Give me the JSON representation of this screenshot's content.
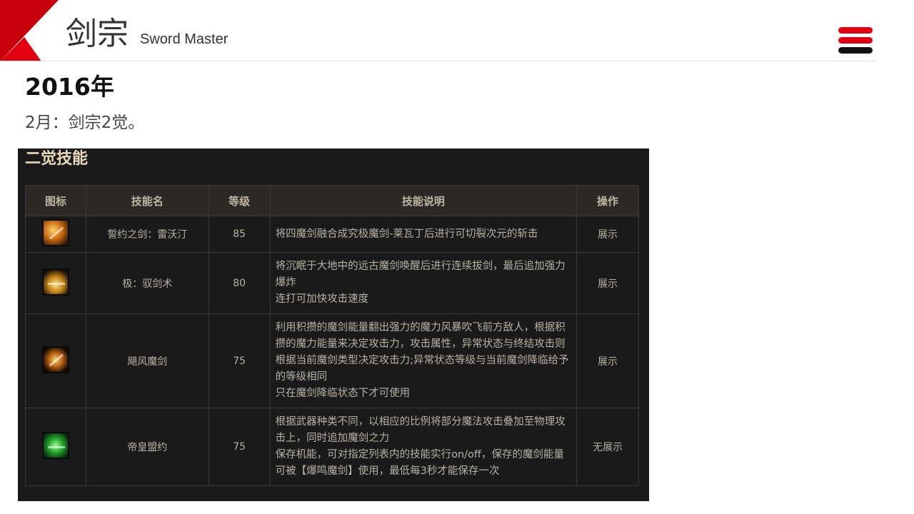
{
  "header": {
    "title": "剑宗",
    "subtitle": "Sword Master",
    "accent_color": "#d7000f"
  },
  "content": {
    "year": "2016年",
    "note": "2月：剑宗2觉。"
  },
  "panel": {
    "title": "二觉技能",
    "columns": [
      "图标",
      "技能名",
      "等级",
      "技能说明",
      "操作"
    ],
    "rows": [
      {
        "icon": "sword-skill-icon",
        "name": "誓约之剑：雷沃汀",
        "level": "85",
        "desc": [
          "将四魔剑融合成究极魔剑-莱瓦丁后进行可切裂次元的斩击"
        ],
        "action": "展示"
      },
      {
        "icon": "crown-skill-icon",
        "name": "极：驭剑术",
        "level": "80",
        "desc": [
          "将沉眠于大地中的远古魔剑唤醒后进行连续拔剑，最后追加强力爆炸",
          "连打可加快攻击速度"
        ],
        "action": "展示"
      },
      {
        "icon": "storm-skill-icon",
        "name": "飓风魔剑",
        "level": "75",
        "desc": [
          "利用积攒的魔剑能量翻出强力的魔力风暴吹飞前方敌人，根据积攒的魔力能量来决定攻击力，攻击属性，异常状态与终结攻击则根据当前魔剑类型决定攻击力;异常状态等级与当前魔剑降临给予的等级相同",
          "只在魔剑降临状态下才可使用"
        ],
        "action": "展示"
      },
      {
        "icon": "emperor-skill-icon",
        "name": "帝皇盟约",
        "level": "75",
        "desc": [
          "根据武器种类不同，以相应的比例将部分魔法攻击叠加至物理攻击上，同时追加魔剑之力",
          "保存机能，可对指定列表内的技能实行on/off，保存的魔剑能量可被【爆鸣魔剑】使用，最低每3秒才能保存一次"
        ],
        "action": "无展示"
      }
    ]
  }
}
